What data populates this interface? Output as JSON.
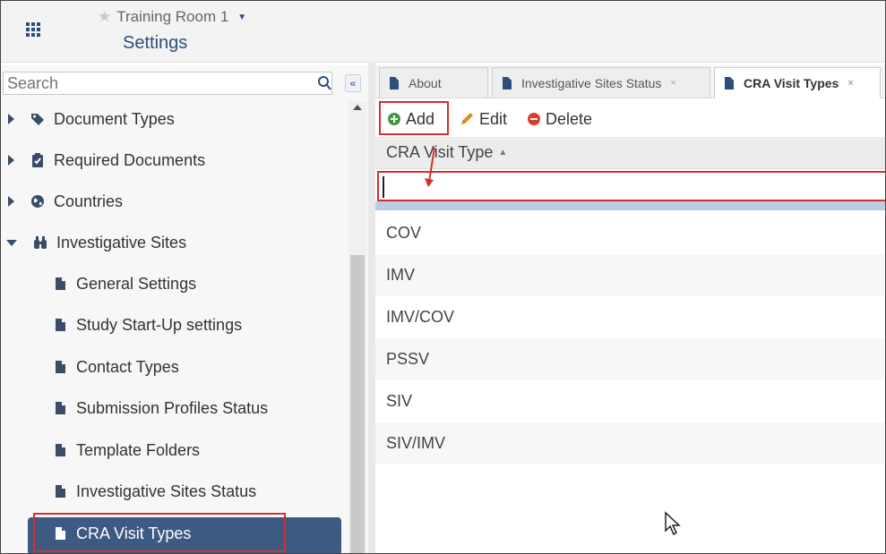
{
  "header": {
    "project_name": "Training Room 1",
    "page_title": "Settings",
    "star_icon": "star-icon",
    "app_grid_icon": "app-grid-icon"
  },
  "search": {
    "placeholder": "Search"
  },
  "tree": [
    {
      "label": "Document Types",
      "icon": "tag-icon",
      "expanded": false
    },
    {
      "label": "Required Documents",
      "icon": "clipboard-icon",
      "expanded": false
    },
    {
      "label": "Countries",
      "icon": "globe-icon",
      "expanded": false
    },
    {
      "label": "Investigative Sites",
      "icon": "binoculars-icon",
      "expanded": true
    },
    {
      "label": "General Settings",
      "icon": "document-icon",
      "child": true
    },
    {
      "label": "Study Start-Up settings",
      "icon": "document-icon",
      "child": true
    },
    {
      "label": "Contact Types",
      "icon": "document-icon",
      "child": true
    },
    {
      "label": "Submission Profiles Status",
      "icon": "document-icon",
      "child": true
    },
    {
      "label": "Template Folders",
      "icon": "document-icon",
      "child": true
    },
    {
      "label": "Investigative Sites Status",
      "icon": "document-icon",
      "child": true
    },
    {
      "label": "CRA Visit Types",
      "icon": "document-icon",
      "child": true,
      "selected": true
    }
  ],
  "tabs": [
    {
      "label": "About",
      "active": false
    },
    {
      "label": "Investigative Sites Status",
      "active": false
    },
    {
      "label": "CRA Visit Types",
      "active": true
    }
  ],
  "toolbar": {
    "add_label": "Add",
    "edit_label": "Edit",
    "delete_label": "Delete"
  },
  "table": {
    "column_header": "CRA Visit Type",
    "new_row_value": "",
    "rows": [
      "COV",
      "IMV",
      "IMV/COV",
      "PSSV",
      "SIV",
      "SIV/IMV"
    ]
  },
  "colors": {
    "brand_blue": "#2c4f7c",
    "selected_bg": "#3d5a83",
    "highlight_red": "#d32f2f",
    "add_green": "#3a9b3a",
    "edit_orange": "#e08a1e",
    "delete_red": "#e03b2c"
  }
}
